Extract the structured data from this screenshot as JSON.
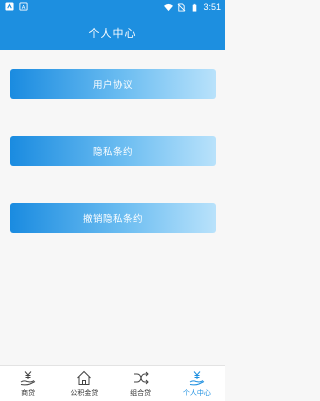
{
  "status_bar": {
    "time": "3:51",
    "icons": [
      "app-notification-icon",
      "android-icon",
      "wifi-icon",
      "no-sim-icon",
      "battery-icon"
    ]
  },
  "header": {
    "title": "个人中心"
  },
  "menu": {
    "items": [
      {
        "label": "用户协议"
      },
      {
        "label": "隐私条约"
      },
      {
        "label": "撤销隐私条约"
      }
    ]
  },
  "tabs": [
    {
      "label": "商贷",
      "icon": "yen-hand-icon",
      "active": false
    },
    {
      "label": "公积金贷",
      "icon": "house-icon",
      "active": false
    },
    {
      "label": "组合贷",
      "icon": "shuffle-icon",
      "active": false
    },
    {
      "label": "个人中心",
      "icon": "yen-hand-icon",
      "active": true
    }
  ],
  "colors": {
    "primary": "#1d8fe0",
    "button_gradient_end": "#b9e2fb",
    "background": "#f7f7f7"
  }
}
